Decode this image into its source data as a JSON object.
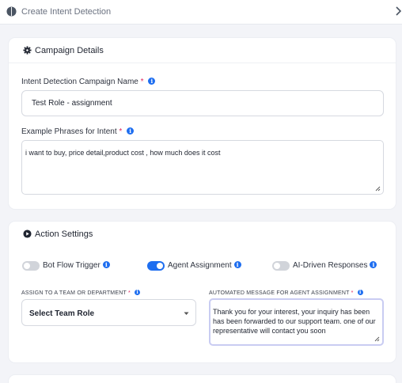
{
  "header": {
    "title": "Create Intent Detection",
    "logo_icon": "brain-icon",
    "close_icon": "chevron-right-icon"
  },
  "campaign": {
    "heading": "Campaign Details",
    "heading_icon": "gear-icon",
    "name_label": "Intent Detection Campaign Name",
    "name_required": "*",
    "name_value": "Test Role - assignment",
    "phrases_label": "Example Phrases for Intent",
    "phrases_required": "*",
    "phrases_value": "i want to buy, price detail,product cost , how much does it cost"
  },
  "action": {
    "heading": "Action Settings",
    "heading_icon": "play-circle-icon",
    "toggles": [
      {
        "label": "Bot Flow Trigger",
        "on": false
      },
      {
        "label": "Agent Assignment",
        "on": true
      },
      {
        "label": "AI-Driven Responses",
        "on": false
      }
    ],
    "assign_label": "ASSIGN TO A TEAM OR DEPARTMENT",
    "assign_required": "*",
    "assign_value": "Select Team Role",
    "message_label": "AUTOMATED MESSAGE FOR AGENT ASSIGNMENT",
    "message_required": "*",
    "message_value": "Thank you for your interest, your inquiry has been has been forwarded to our support team. one of our representative will contact you soon"
  },
  "colors": {
    "accent": "#1e6ef0",
    "required": "#e0245e",
    "focus_border": "#c9ccf2"
  }
}
